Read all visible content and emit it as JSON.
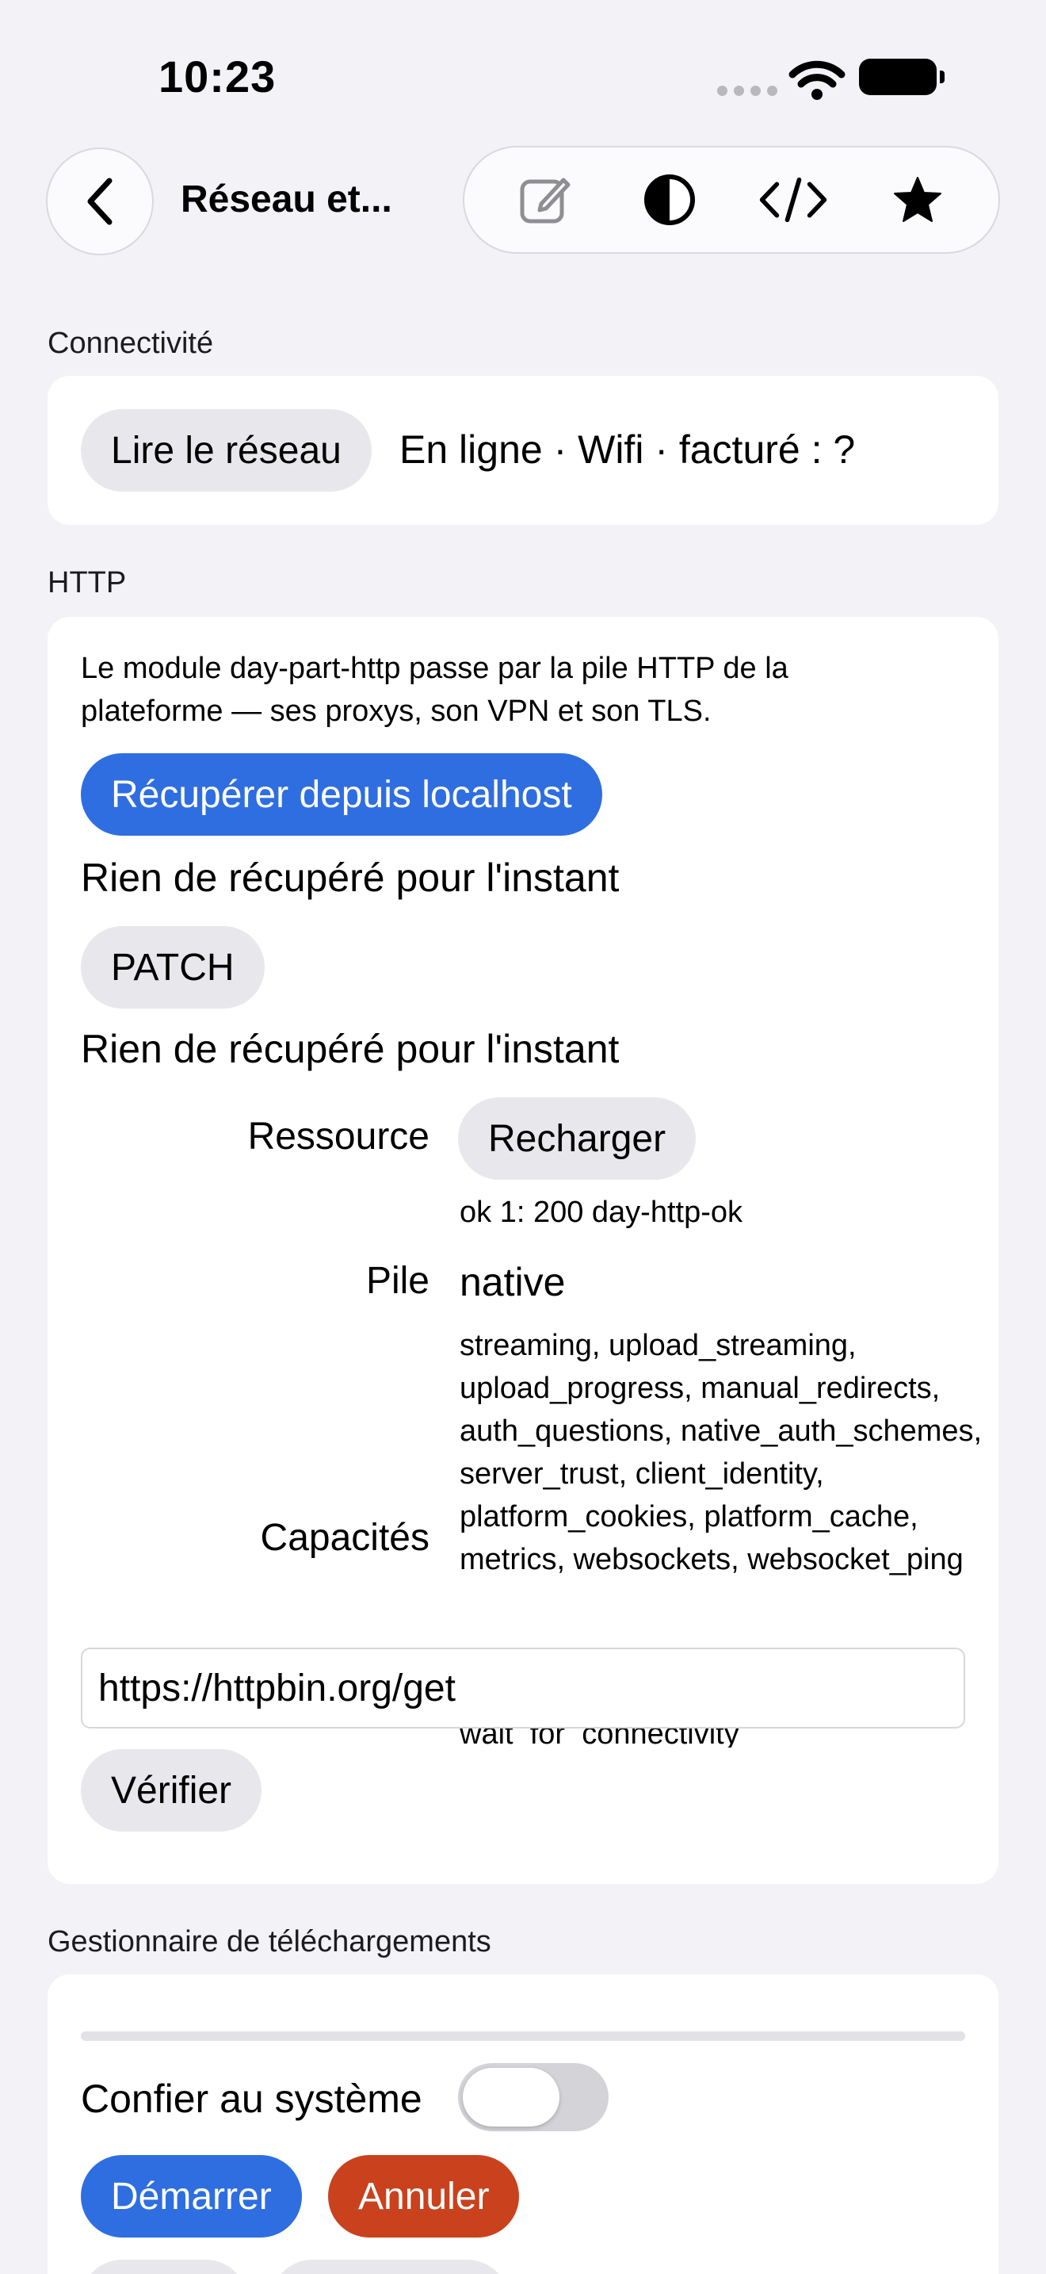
{
  "status_bar": {
    "time": "10:23"
  },
  "nav": {
    "title": "Réseau et..."
  },
  "icons": {
    "back": "chevron-left-icon",
    "edit": "edit-icon",
    "contrast": "contrast-icon",
    "code": "code-icon",
    "favorite": "star-icon"
  },
  "colors": {
    "accent": "#2f6ee0",
    "danger": "#c9421d",
    "background": "#f2f2f7"
  },
  "connectivity": {
    "section_title": "Connectivité",
    "read_button": "Lire le réseau",
    "status": "En ligne · Wifi · facturé : ?"
  },
  "http": {
    "section_title": "HTTP",
    "description": "Le module day-part-http passe par la pile HTTP de la plateforme — ses proxys, son VPN et son TLS.",
    "fetch_button": "Récupérer depuis localhost",
    "fetch_result": "Rien de récupéré pour l'instant",
    "patch_button": "PATCH",
    "patch_result": "Rien de récupéré pour l'instant",
    "resource_label": "Ressource",
    "reload_button": "Recharger",
    "resource_result": "ok 1: 200 day-http-ok",
    "stack_label": "Pile",
    "stack_value": "native",
    "capabilities_label": "Capacités",
    "capabilities": "streaming, upload_streaming, upload_progress, manual_redirects, auth_questions, native_auth_schemes, server_trust, client_identity, platform_cookies, platform_cache, metrics, websockets, websocket_ping",
    "capabilities_tail": "wait_for_connectivity",
    "url_value": "https://httpbin.org/get",
    "verify_button": "Vérifier"
  },
  "downloads": {
    "section_title": "Gestionnaire de téléchargements",
    "progress": 0,
    "delegate_label": "Confier au système",
    "delegate_on": false,
    "start_button": "Démarrer",
    "cancel_button": "Annuler"
  }
}
